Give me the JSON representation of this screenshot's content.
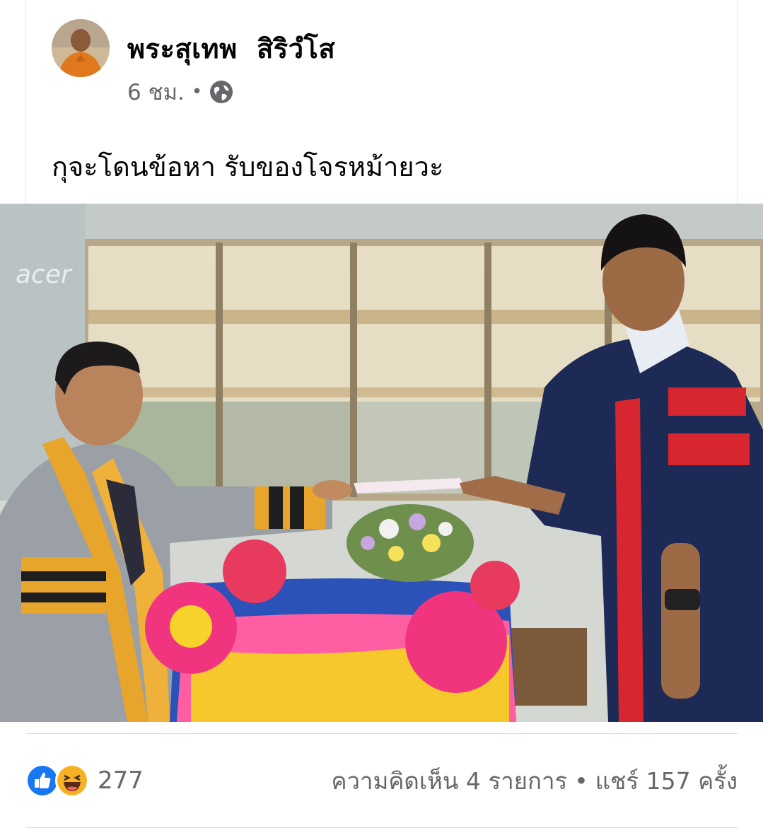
{
  "post": {
    "author": "พระสุเทพ  สิริวํโส",
    "time": "6 ชม.",
    "separator": "•",
    "visibility_icon": "globe-icon",
    "caption": "กุจะโดนข้อหา รับของโจรหม้ายวะ"
  },
  "photo": {
    "description_icon": "photo",
    "screen_logo": "acer"
  },
  "footer": {
    "reaction_icons": [
      "like-icon",
      "haha-icon"
    ],
    "reaction_count": "277",
    "comments": "ความคิดเห็น 4 รายการ",
    "dot": "•",
    "shares": "แชร์ 157 ครั้ง"
  },
  "colors": {
    "like_blue": "#1877f2",
    "haha_yellow": "#f7b125",
    "secondary_text": "#65676b"
  }
}
